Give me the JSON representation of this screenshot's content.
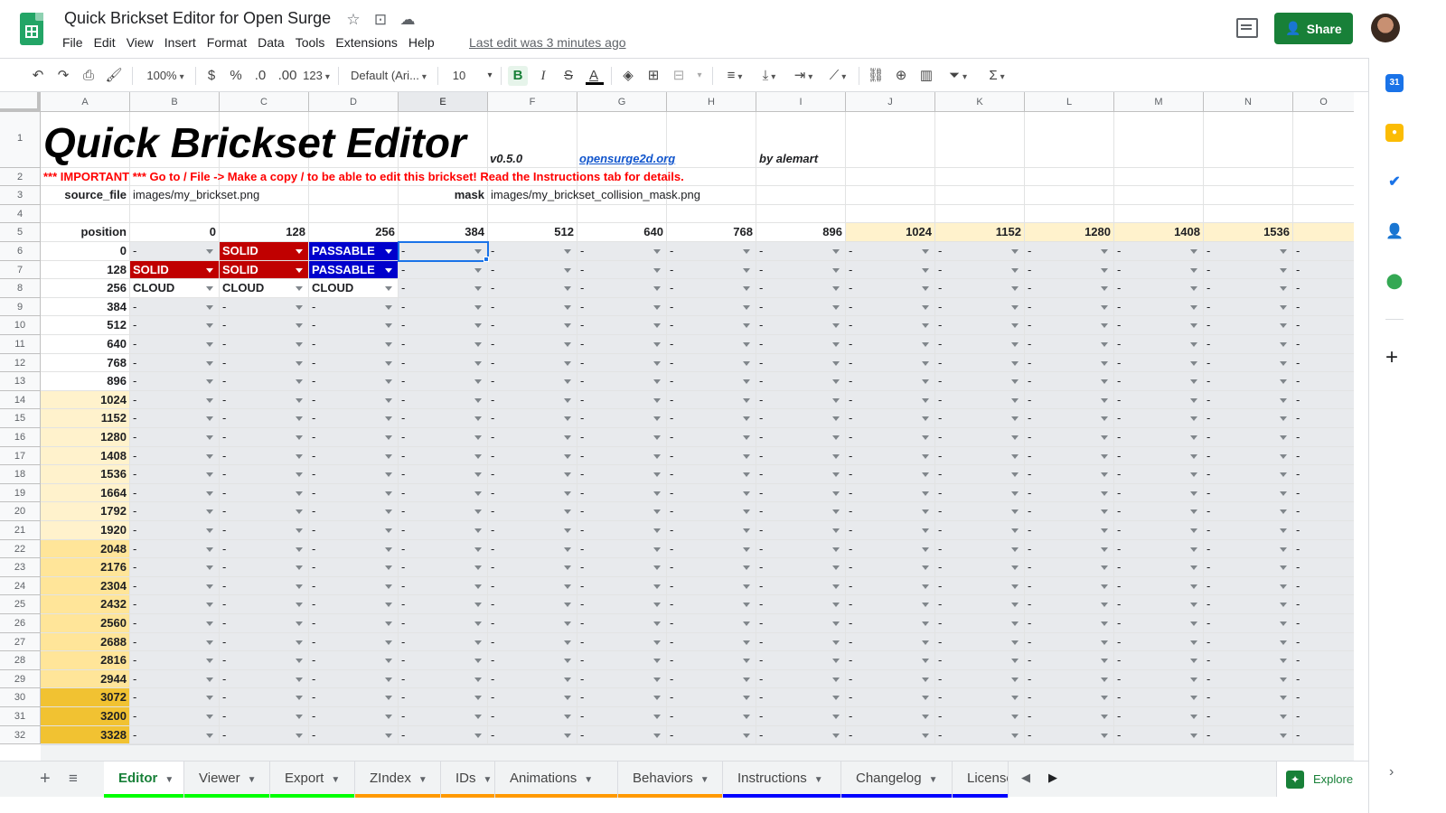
{
  "app": {
    "title": "Quick Brickset Editor for Open Surge",
    "last_edit": "Last edit was 3 minutes ago",
    "share_label": "Share"
  },
  "menu": [
    "File",
    "Edit",
    "View",
    "Insert",
    "Format",
    "Data",
    "Tools",
    "Extensions",
    "Help"
  ],
  "toolbar": {
    "zoom": "100%",
    "currency": "$",
    "percent": "%",
    "dec_less": ".0",
    "dec_more": ".00",
    "format_more": "123",
    "font": "Default (Ari...",
    "font_size": "10"
  },
  "columns": [
    "A",
    "B",
    "C",
    "D",
    "E",
    "F",
    "G",
    "H",
    "I",
    "J",
    "K",
    "L",
    "M",
    "N",
    "O"
  ],
  "sheet": {
    "title": "Quick Brickset Editor",
    "version": "v0.5.0",
    "site": "opensurge2d.org",
    "author": "by alemart",
    "important": "*** IMPORTANT *** Go to / File -> Make a copy / to be able to edit this brickset! Read the Instructions tab for details.",
    "source_label": "source_file",
    "source_value": "images/my_brickset.png",
    "mask_label": "mask",
    "mask_value": "images/my_brickset_collision_mask.png",
    "position_label": "position",
    "col_positions": [
      "0",
      "128",
      "256",
      "384",
      "512",
      "640",
      "768",
      "896",
      "1024",
      "1152",
      "1280",
      "1408",
      "1536"
    ],
    "row_positions": [
      "0",
      "128",
      "256",
      "384",
      "512",
      "640",
      "768",
      "896",
      "1024",
      "1152",
      "1280",
      "1408",
      "1536",
      "1664",
      "1792",
      "1920",
      "2048",
      "2176",
      "2304",
      "2432",
      "2560",
      "2688",
      "2816",
      "2944",
      "3072",
      "3200",
      "3328"
    ],
    "special_cells": [
      {
        "row": 0,
        "col": 1,
        "text": "SOLID",
        "style": "red"
      },
      {
        "row": 0,
        "col": 2,
        "text": "PASSABLE",
        "style": "blue"
      },
      {
        "row": 1,
        "col": 0,
        "text": "SOLID",
        "style": "red"
      },
      {
        "row": 1,
        "col": 1,
        "text": "SOLID",
        "style": "red"
      },
      {
        "row": 1,
        "col": 2,
        "text": "PASSABLE",
        "style": "blue"
      },
      {
        "row": 2,
        "col": 0,
        "text": "CLOUD",
        "style": "white"
      },
      {
        "row": 2,
        "col": 1,
        "text": "CLOUD",
        "style": "white"
      },
      {
        "row": 2,
        "col": 2,
        "text": "CLOUD",
        "style": "white"
      }
    ],
    "empty_value": "-",
    "selected_cell": "E6",
    "row_shades": [
      "#fff2cc",
      "#ffe599",
      "#f1c232"
    ],
    "col_shade": "#fff2cc"
  },
  "tabs": [
    {
      "label": "Editor",
      "color": "#00ff00",
      "active": true
    },
    {
      "label": "Viewer",
      "color": "#00ff00"
    },
    {
      "label": "Export",
      "color": "#00ff00"
    },
    {
      "label": "ZIndex",
      "color": "#ff9900"
    },
    {
      "label": "IDs",
      "color": "#ff9900"
    },
    {
      "label": "Animations",
      "color": "#ff9900"
    },
    {
      "label": "Behaviors",
      "color": "#ff9900"
    },
    {
      "label": "Instructions",
      "color": "#0000ff"
    },
    {
      "label": "Changelog",
      "color": "#0000ff"
    },
    {
      "label": "License",
      "color": "#0000ff"
    }
  ],
  "explore_label": "Explore",
  "side_panel": [
    "calendar-icon",
    "keep-icon",
    "tasks-icon",
    "contacts-icon",
    "maps-icon"
  ]
}
